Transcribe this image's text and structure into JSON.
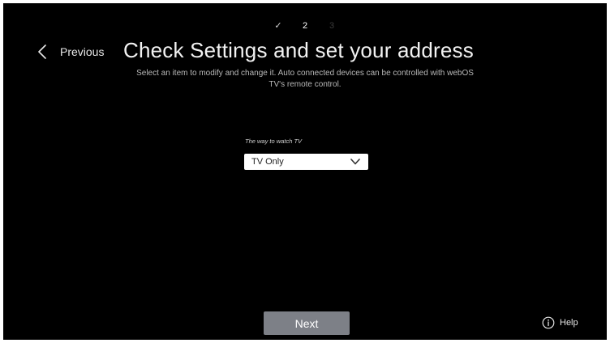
{
  "steps": [
    {
      "label": "✓",
      "state": "done"
    },
    {
      "label": "2",
      "state": "current"
    },
    {
      "label": "3",
      "state": "future"
    }
  ],
  "nav": {
    "previous_label": "Previous",
    "previous_icon": "chevron-left-icon"
  },
  "header": {
    "title": "Check Settings and set your address",
    "subtitle_line1": "Select an item to modify and change it. Auto connected devices can be controlled with webOS",
    "subtitle_line2": "TV's remote control."
  },
  "watch_tv": {
    "label": "The way to watch TV",
    "selected": "TV Only",
    "icon": "chevron-down-icon"
  },
  "footer": {
    "next_label": "Next",
    "help_label": "Help",
    "help_icon": "info-circle-icon"
  },
  "colors": {
    "background": "#000000",
    "next_button": "#7d8087",
    "select_bg": "#ffffff"
  }
}
